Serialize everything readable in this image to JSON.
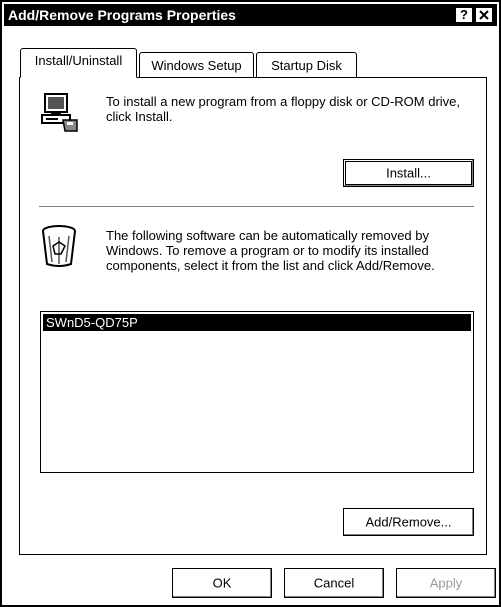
{
  "window": {
    "title": "Add/Remove Programs Properties",
    "help_label": "?",
    "close_label": "✕"
  },
  "tabs": [
    {
      "label": "Install/Uninstall",
      "active": true
    },
    {
      "label": "Windows Setup",
      "active": false
    },
    {
      "label": "Startup Disk",
      "active": false
    }
  ],
  "install_section": {
    "icon": "computer-floppy-icon",
    "text": "To install a new program from a floppy disk or CD-ROM drive, click Install.",
    "button_label": "Install..."
  },
  "remove_section": {
    "icon": "recycle-bin-icon",
    "text": "The following software can be automatically removed by Windows. To remove a program or to modify its installed components, select it from the list and click Add/Remove.",
    "list_items": [
      "SWnD5-QD75P"
    ],
    "selected_index": 0,
    "button_label": "Add/Remove..."
  },
  "footer": {
    "ok_label": "OK",
    "cancel_label": "Cancel",
    "apply_label": "Apply",
    "apply_enabled": false
  }
}
